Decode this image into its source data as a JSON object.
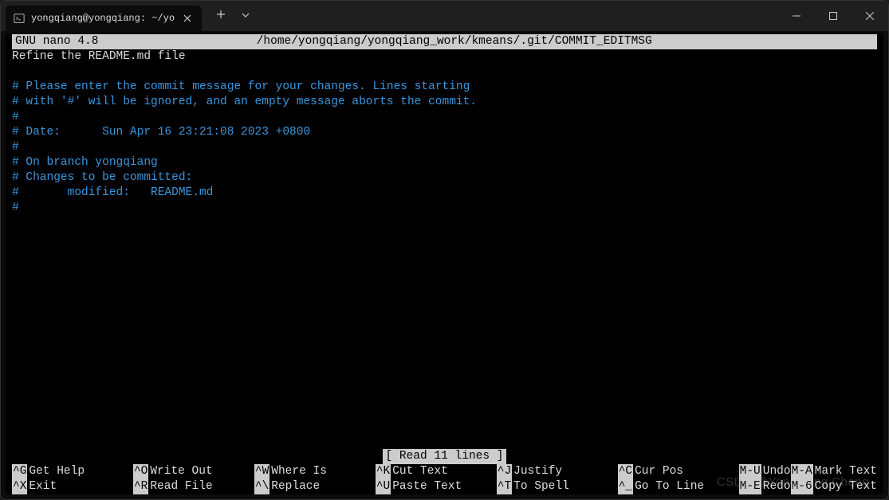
{
  "window": {
    "tab_title": "yongqiang@yongqiang: ~/yo"
  },
  "nano": {
    "version": "GNU nano 4.8",
    "filepath": "/home/yongqiang/yongqiang_work/kmeans/.git/COMMIT_EDITMSG",
    "status": "[ Read 11 lines ]"
  },
  "content": {
    "line1": "Refine the README.md file",
    "line2": "",
    "line3": "# Please enter the commit message for your changes. Lines starting",
    "line4": "# with '#' will be ignored, and an empty message aborts the commit.",
    "line5": "#",
    "line6": "# Date:      Sun Apr 16 23:21:08 2023 +0800",
    "line7": "#",
    "line8": "# On branch yongqiang",
    "line9": "# Changes to be committed:",
    "line10": "#       modified:   README.md",
    "line11": "#"
  },
  "shortcuts": {
    "s1": {
      "key": "^G",
      "label": "Get Help"
    },
    "s2": {
      "key": "^X",
      "label": "Exit"
    },
    "s3": {
      "key": "^O",
      "label": "Write Out"
    },
    "s4": {
      "key": "^R",
      "label": "Read File"
    },
    "s5": {
      "key": "^W",
      "label": "Where Is"
    },
    "s6": {
      "key": "^\\",
      "label": "Replace"
    },
    "s7": {
      "key": "^K",
      "label": "Cut Text"
    },
    "s8": {
      "key": "^U",
      "label": "Paste Text"
    },
    "s9": {
      "key": "^J",
      "label": "Justify"
    },
    "s10": {
      "key": "^T",
      "label": "To Spell"
    },
    "s11": {
      "key": "^C",
      "label": "Cur Pos"
    },
    "s12": {
      "key": "^_",
      "label": "Go To Line"
    },
    "s13": {
      "key": "M-U",
      "label": "Undo"
    },
    "s14": {
      "key": "M-E",
      "label": "Redo"
    },
    "s15": {
      "key": "M-A",
      "label": "Mark Text"
    },
    "s16": {
      "key": "M-6",
      "label": "Copy Text"
    }
  },
  "watermark": "CSDN @Yongqiang Cheng"
}
